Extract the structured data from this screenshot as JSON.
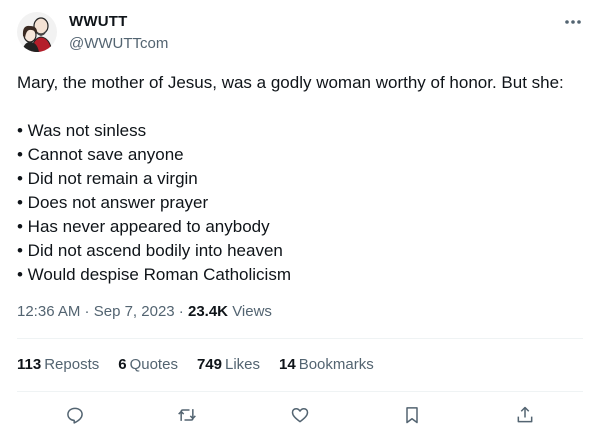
{
  "author": {
    "display_name": "WWUTT",
    "handle": "@WWUTTcom",
    "avatar_icon": "caricature-avatar-icon"
  },
  "tweet": {
    "intro": "Mary, the mother of Jesus, was a godly woman worthy of honor. But she:",
    "bullets": [
      "• Was not sinless",
      "• Cannot save anyone",
      "• Did not remain a virgin",
      "• Does not answer prayer",
      "• Has never appeared to anybody",
      "• Did not ascend bodily into heaven",
      "• Would despise Roman Catholicism"
    ]
  },
  "meta": {
    "time": "12:36 AM",
    "separator": " · ",
    "date": "Sep 7, 2023",
    "views_count": "23.4K",
    "views_label": "Views"
  },
  "stats": [
    {
      "count": "113",
      "label": "Reposts"
    },
    {
      "count": "6",
      "label": "Quotes"
    },
    {
      "count": "749",
      "label": "Likes"
    },
    {
      "count": "14",
      "label": "Bookmarks"
    }
  ],
  "actions": [
    "reply-icon",
    "repost-icon",
    "like-icon",
    "bookmark-icon",
    "share-icon"
  ],
  "colors": {
    "text": "#0f1419",
    "secondary": "#536471",
    "divider": "#eff3f4"
  }
}
